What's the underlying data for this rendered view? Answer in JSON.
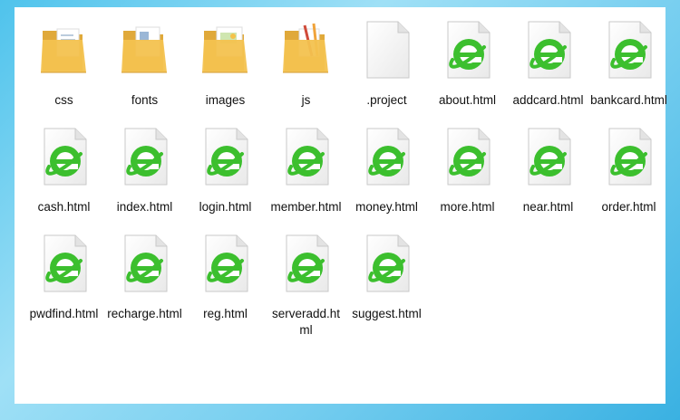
{
  "items": [
    {
      "name": "css",
      "type": "folder",
      "variant": "docs"
    },
    {
      "name": "fonts",
      "type": "folder",
      "variant": "fonts"
    },
    {
      "name": "images",
      "type": "folder",
      "variant": "images"
    },
    {
      "name": "js",
      "type": "folder",
      "variant": "pencils"
    },
    {
      "name": ".project",
      "type": "file"
    },
    {
      "name": "about.html",
      "type": "html"
    },
    {
      "name": "addcard.html",
      "type": "html"
    },
    {
      "name": "bankcard.html",
      "type": "html"
    },
    {
      "name": "cash.html",
      "type": "html"
    },
    {
      "name": "index.html",
      "type": "html"
    },
    {
      "name": "login.html",
      "type": "html"
    },
    {
      "name": "member.html",
      "type": "html"
    },
    {
      "name": "money.html",
      "type": "html"
    },
    {
      "name": "more.html",
      "type": "html"
    },
    {
      "name": "near.html",
      "type": "html"
    },
    {
      "name": "order.html",
      "type": "html"
    },
    {
      "name": "pwdfind.html",
      "type": "html"
    },
    {
      "name": "recharge.html",
      "type": "html"
    },
    {
      "name": "reg.html",
      "type": "html"
    },
    {
      "name": "serveradd.html",
      "type": "html"
    },
    {
      "name": "suggest.html",
      "type": "html"
    }
  ],
  "colors": {
    "folder": "#f3c24f",
    "folder_dark": "#e0a93a",
    "ie_green": "#3cbf2e",
    "page": "#f7f7f7"
  }
}
